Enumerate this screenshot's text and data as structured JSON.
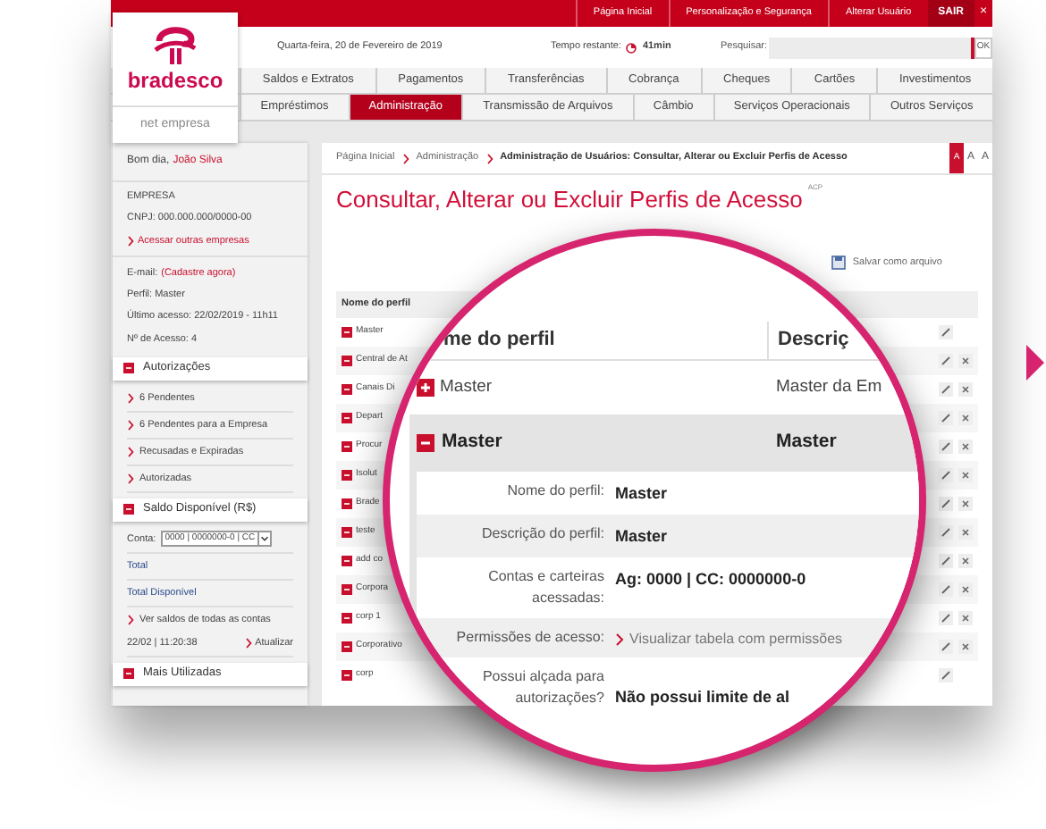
{
  "header": {
    "top_links": [
      "Página Inicial",
      "Personalização e Segurança",
      "Alterar Usuário"
    ],
    "exit": "SAIR",
    "close": "×",
    "logo": {
      "name": "bradesco",
      "product": "net empresa"
    },
    "date": "Quarta-feira, 20 de Fevereiro de 2019",
    "timer_label": "Tempo restante:",
    "timer": "41min",
    "search": {
      "label": "Pesquisar:",
      "button": "OK"
    }
  },
  "nav": {
    "upper": [
      {
        "label": "Saldos e Extratos",
        "selected": false
      },
      {
        "label": "Pagamentos",
        "selected": false
      },
      {
        "label": "Transferências",
        "selected": false
      },
      {
        "label": "Cobrança",
        "selected": false
      },
      {
        "label": "Cheques",
        "selected": false
      },
      {
        "label": "Cartões",
        "selected": false
      },
      {
        "label": "Investimentos",
        "selected": false
      }
    ],
    "lower": [
      {
        "label": "Empréstimos",
        "selected": false
      },
      {
        "label": "Administração",
        "selected": true
      },
      {
        "label": "Transmissão de Arquivos",
        "selected": false
      },
      {
        "label": "Câmbio",
        "selected": false
      },
      {
        "label": "Serviços Operacionais",
        "selected": false
      },
      {
        "label": "Outros Serviços",
        "selected": false
      }
    ]
  },
  "sidebar": {
    "greeting": "Bom dia,",
    "user_name": "João Silva",
    "company": {
      "label": "EMPRESA",
      "cnpj": "CNPJ: 000.000.000/0000-00",
      "link": "Acessar outras empresas"
    },
    "email": {
      "label": "E-mail:",
      "link": "(Cadastre agora)"
    },
    "info": [
      "Perfil: Master",
      "Último acesso: 22/02/2019 - 11h11",
      "Nº de Acesso: 4"
    ],
    "authorizations": {
      "title": "Autorizações",
      "links": [
        "6 Pendentes",
        "6 Pendentes para a Empresa",
        "Recusadas e Expiradas",
        "Autorizadas"
      ]
    },
    "balance": {
      "title": "Saldo Disponível (R$)",
      "account_label": "Conta:",
      "account": "0000 | 0000000-0 | CC",
      "total": "Total",
      "total_available": "Total Disponível",
      "all_accounts": "Ver saldos de todas as contas",
      "timestamp": "22/02 | 11:20:38",
      "refresh": "Atualizar"
    },
    "most_used": {
      "title": "Mais Utilizadas"
    }
  },
  "main": {
    "breadcrumb": [
      "Página Inicial",
      "Administração",
      "Administração de Usuários: Consultar, Alterar ou Excluir Perfis de Acesso"
    ],
    "font_sizes": [
      {
        "label": "A",
        "selected": true
      },
      {
        "label": "A",
        "selected": false
      },
      {
        "label": "A",
        "selected": false
      }
    ],
    "title": "Consultar, Alterar ou Excluir Perfis de Acesso",
    "code": "ACP",
    "save": "Salvar como arquivo",
    "table": {
      "column": "Nome do perfil",
      "rows": [
        {
          "name": "Master",
          "deletable": false
        },
        {
          "name": "Central de At",
          "deletable": true
        },
        {
          "name": "Canais Di",
          "deletable": true
        },
        {
          "name": "Depart",
          "deletable": true
        },
        {
          "name": "Procur",
          "deletable": true
        },
        {
          "name": "Isolut",
          "deletable": true
        },
        {
          "name": "Brade",
          "deletable": true
        },
        {
          "name": "teste",
          "deletable": true
        },
        {
          "name": "add co",
          "deletable": true
        },
        {
          "name": "Corpora",
          "deletable": true
        },
        {
          "name": "corp 1",
          "deletable": true
        },
        {
          "name": "Corporativo",
          "deletable": true
        },
        {
          "name": "corp",
          "deletable": false
        }
      ]
    }
  },
  "magnifier": {
    "columns": [
      "me do perfil",
      "Descriç"
    ],
    "rows": [
      {
        "name": "Master",
        "description": "Master da Em",
        "expanded": false
      },
      {
        "name": "Master",
        "description": "Master",
        "expanded": true
      }
    ],
    "details": [
      {
        "label": "Nome do perfil:",
        "value": "Master",
        "kind": "text"
      },
      {
        "label": "Descrição do perfil:",
        "value": "Master",
        "kind": "text"
      },
      {
        "label": "Contas e carteiras acessadas:",
        "value": "Ag: 0000 | CC: 0000000-0",
        "kind": "text"
      },
      {
        "label": "Permissões de acesso:",
        "value": "Visualizar tabela com permissões",
        "kind": "link"
      },
      {
        "label": "Possui alçada para autorizações?",
        "value": "Não possui limite de al",
        "kind": "text"
      }
    ]
  }
}
